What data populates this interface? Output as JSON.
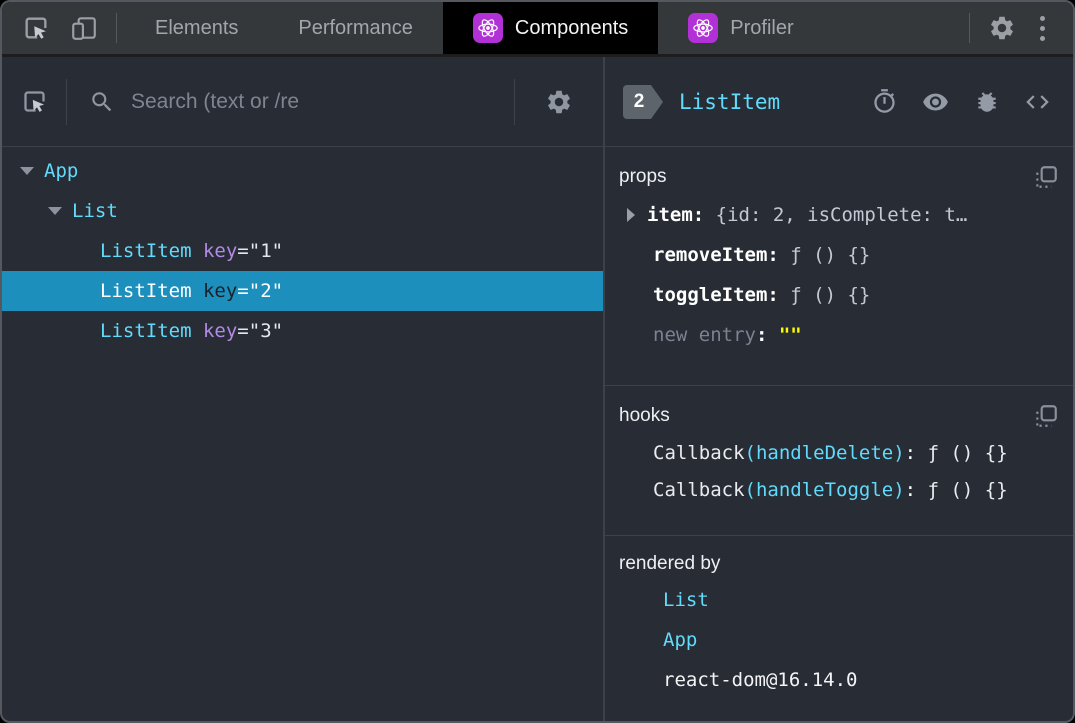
{
  "topbar": {
    "tabs": [
      {
        "label": "Elements"
      },
      {
        "label": "Performance"
      },
      {
        "label": "Components"
      },
      {
        "label": "Profiler"
      }
    ]
  },
  "left_toolbar": {
    "search_placeholder": "Search (text or /re"
  },
  "tree": {
    "rows": [
      {
        "name": "App"
      },
      {
        "name": "List"
      },
      {
        "name": "ListItem",
        "attr": "key",
        "eq": "=",
        "value": "\"1\""
      },
      {
        "name": "ListItem",
        "attr": "key",
        "eq": "=",
        "value": "\"2\""
      },
      {
        "name": "ListItem",
        "attr": "key",
        "eq": "=",
        "value": "\"3\""
      }
    ]
  },
  "inspector": {
    "badge": "2",
    "component": "ListItem",
    "props": {
      "title": "props",
      "rows": [
        {
          "key": "item",
          "sep": ":",
          "value": " {id: 2, isComplete: t…"
        },
        {
          "key": "removeItem",
          "sep": ":",
          "value": " ƒ () {}"
        },
        {
          "key": "toggleItem",
          "sep": ":",
          "value": " ƒ () {}"
        },
        {
          "key": "new entry",
          "sep": ":",
          "value": " \"\""
        }
      ]
    },
    "hooks": {
      "title": "hooks",
      "rows": [
        {
          "key": "Callback",
          "paren": "(handleDelete)",
          "sep": ":",
          "value": " ƒ () {}"
        },
        {
          "key": "Callback",
          "paren": "(handleToggle)",
          "sep": ":",
          "value": " ƒ () {}"
        }
      ]
    },
    "rendered_by": {
      "title": "rendered by",
      "items": [
        "List",
        "App",
        "react-dom@16.14.0"
      ]
    }
  },
  "colors": {
    "panel_bg": "#282c34",
    "topbar_bg": "#35383b",
    "active_tab_bg": "#000000",
    "selected_row": "#1d8fbd",
    "accent_cyan": "#61dafb",
    "attr_purple": "#b389e6",
    "editable_yellow": "#fafa00",
    "react_purple": "#b231d6"
  }
}
